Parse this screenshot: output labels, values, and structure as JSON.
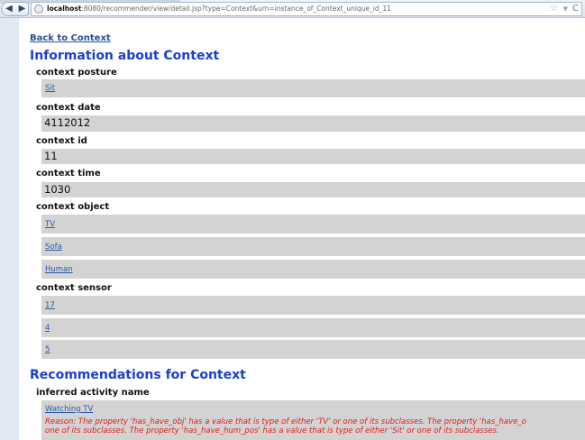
{
  "browser": {
    "back_icon": "arrow-left-icon",
    "forward_icon": "arrow-right-icon",
    "url_host": "localhost",
    "url_rest": ":8080/recommender/view/detail.jsp?type=Context&urn=instance_of_Context_unique_id_11",
    "star": "☆",
    "dropdown": "▼",
    "reload": "C"
  },
  "page": {
    "back_link": "Back to Context",
    "info_heading": "Information about Context",
    "posture": {
      "label": "context posture",
      "values": [
        "Sit"
      ]
    },
    "date": {
      "label": "context date",
      "value": "4112012"
    },
    "id": {
      "label": "context id",
      "value": "11"
    },
    "time": {
      "label": "context time",
      "value": "1030"
    },
    "object": {
      "label": "context object",
      "values": [
        "TV",
        "Sofa",
        "Human"
      ]
    },
    "sensor": {
      "label": "context sensor",
      "values": [
        "17",
        "4",
        "5"
      ]
    },
    "rec_heading": "Recommendations for Context",
    "activity": {
      "label": "inferred activity name",
      "value": "Watching TV",
      "reason_line1": "Reason: The property 'has_have_obj' has a value that is type of either 'TV' or one of its subclasses. The property 'has_have_o",
      "reason_line2": "one of its subclasses. The property 'has_have_hum_pos' has a value that is type of either 'Sit' or one of its subclasses."
    }
  },
  "colors": {
    "heading": "#1b3fcf",
    "link": "#2b5aa8",
    "row_bg": "#d3d3d3",
    "reason": "#e31b1b"
  }
}
